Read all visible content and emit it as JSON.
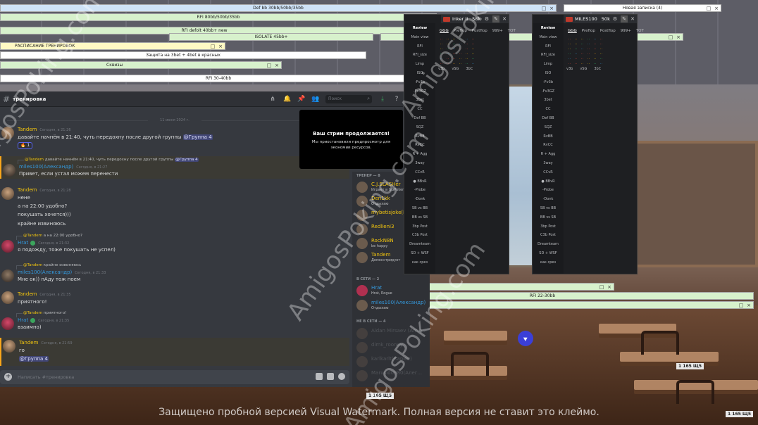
{
  "notes": {
    "n1": "Def bb 30bb/50bb/35bb",
    "n2": "RFI 80bb/50bb/35bb",
    "n3": "RFI defolt 40bb+ new",
    "n4": "ISOLATE 45bb+",
    "n5": "РАСПИСАНИЕ ТРЕНИРОВОК",
    "n6": "Защита на 3bet + 4bet в красных",
    "n7": "Сквизы",
    "n8": "RFI 30-40bb",
    "n9": "Новая записка (4)",
    "n10": "RFI 22-30bb",
    "ctl_min": "□",
    "ctl_close": "×"
  },
  "discord": {
    "channel": "тренировка",
    "search_placeholder": "Поиск",
    "date_divider": "11 июня 2024 г.",
    "input_placeholder": "Написать #тренировка",
    "messages": [
      {
        "author": "Tandem",
        "time": "Сегодня, в 21:26",
        "text": "давайте начнём в 21:40, чуть передохну после другой группы",
        "mention": "@Группа 4",
        "reaction": "🔥 1"
      },
      {
        "reply_author": "@Tandem",
        "reply_text": "давайте начнём в 21:40, чуть передохну после другой группы",
        "reply_mention": "@Группа 4",
        "author": "miles100(Александр)",
        "time": "Сегодня, в 21:27",
        "text": "Привет, если устал можем перенести"
      },
      {
        "author": "Tandem",
        "time": "Сегодня, в 21:28",
        "lines": [
          "нене",
          "а на 22:00 удобно?",
          "покушать хочется)))",
          "крайне извиняюсь"
        ]
      },
      {
        "reply_author": "@Tandem",
        "reply_text": "а на 22:00 удобно?",
        "author": "Hrat",
        "time": "Сегодня, в 21:32",
        "text": "я подожду, тоже покушать не успел)"
      },
      {
        "reply_author": "@Tandem",
        "reply_text": "крайне извиняюсь",
        "author": "miles100(Александр)",
        "time": "Сегодня, в 21:33",
        "text": "Мне ок)) пАду тож поем"
      },
      {
        "author": "Tandem",
        "time": "Сегодня, в 21:35",
        "text": "приятного!"
      },
      {
        "reply_author": "@Tandem",
        "reply_text": "приятного!",
        "author": "Hrat",
        "time": "Сегодня, в 21:35",
        "text": "взаимно)"
      },
      {
        "author": "Tandem",
        "time": "Сегодня, в 21:59",
        "lines": [
          "го"
        ],
        "mention": "@Группа 4"
      }
    ],
    "stream": {
      "title": "Ваш стрим продолжается!",
      "body": "Мы приостановили предпросмотр для экономии ресурсов."
    },
    "members": {
      "trainer_header": "ТРЕНЕР — 8",
      "online_header": "В СЕТИ — 2",
      "offline_header": "НЕ В СЕТИ — 4",
      "trainers": [
        {
          "name": "C.J.SLASHer",
          "status": "Играет в GGPoker",
          "color": "#f1c40f"
        },
        {
          "name": "Den1kk",
          "status": "Отдыхаю",
          "color": "#f1c40f"
        },
        {
          "name": "mybetisjoke(К...",
          "status": "",
          "color": "#f1c40f"
        },
        {
          "name": "RedlIeni3",
          "status": "",
          "color": "#f1c40f"
        },
        {
          "name": "RockN8N",
          "status": "be happy",
          "color": "#f1c40f"
        },
        {
          "name": "Tandem",
          "status": "Демонстрирует",
          "color": "#f1c40f"
        }
      ],
      "online": [
        {
          "name": "Hrat",
          "status": "Hrat, Rogue",
          "color": "#3498db"
        },
        {
          "name": "miles100(Александр)",
          "status": "Отдыхаю",
          "color": "#3498db"
        }
      ],
      "offline": [
        {
          "name": "Aidan Mirsaev (Amig...",
          "status": "",
          "color": "#8e9297"
        },
        {
          "name": "dimk_rooney",
          "status": "",
          "color": "#8e9297"
        },
        {
          "name": "karlkarlt(Карим)",
          "status": "",
          "color": "#8e9297"
        },
        {
          "name": "Marusid0980(Алег...",
          "status": "",
          "color": "#8e9297"
        }
      ]
    }
  },
  "hud1": {
    "name": "Inker II",
    "value": "58k"
  },
  "hud2": {
    "name": "MILES100",
    "value": "50k"
  },
  "hud_menu": [
    "Review",
    "Main view",
    "RFI",
    "RFI_size",
    "Limp",
    "ISO",
    "-Fv3b",
    "-Fv3GZ",
    "3bet",
    "CC",
    "Def BB",
    "SQZ",
    "RvBB",
    "RvCC",
    "R + Agg",
    "3way",
    "CCvR",
    "● BBvR",
    "-Probe",
    "-Donk",
    "SB vs BB",
    "BB vs SB",
    "3bp Post",
    "C3b Post",
    "Dreamteam",
    "SD + WSF",
    "как срез"
  ],
  "hud_tabs": [
    "GGG",
    "Preflop",
    "Postflop",
    "999+",
    "TOT"
  ],
  "hud_sub": [
    "v3b",
    "vSG",
    "3bC"
  ],
  "watermark": {
    "diag": "AmigosPoking.com",
    "bottom": "Защищено пробной версией Visual Watermark. Полная версия не ставит это клеймо."
  },
  "plates": [
    "1 165 Щ5",
    "1 165 Щ5",
    "1 165 Щ5"
  ],
  "colors": {
    "accent_yellow": "#f1c40f",
    "accent_blue": "#3498db",
    "discord_bg": "#36393f"
  }
}
